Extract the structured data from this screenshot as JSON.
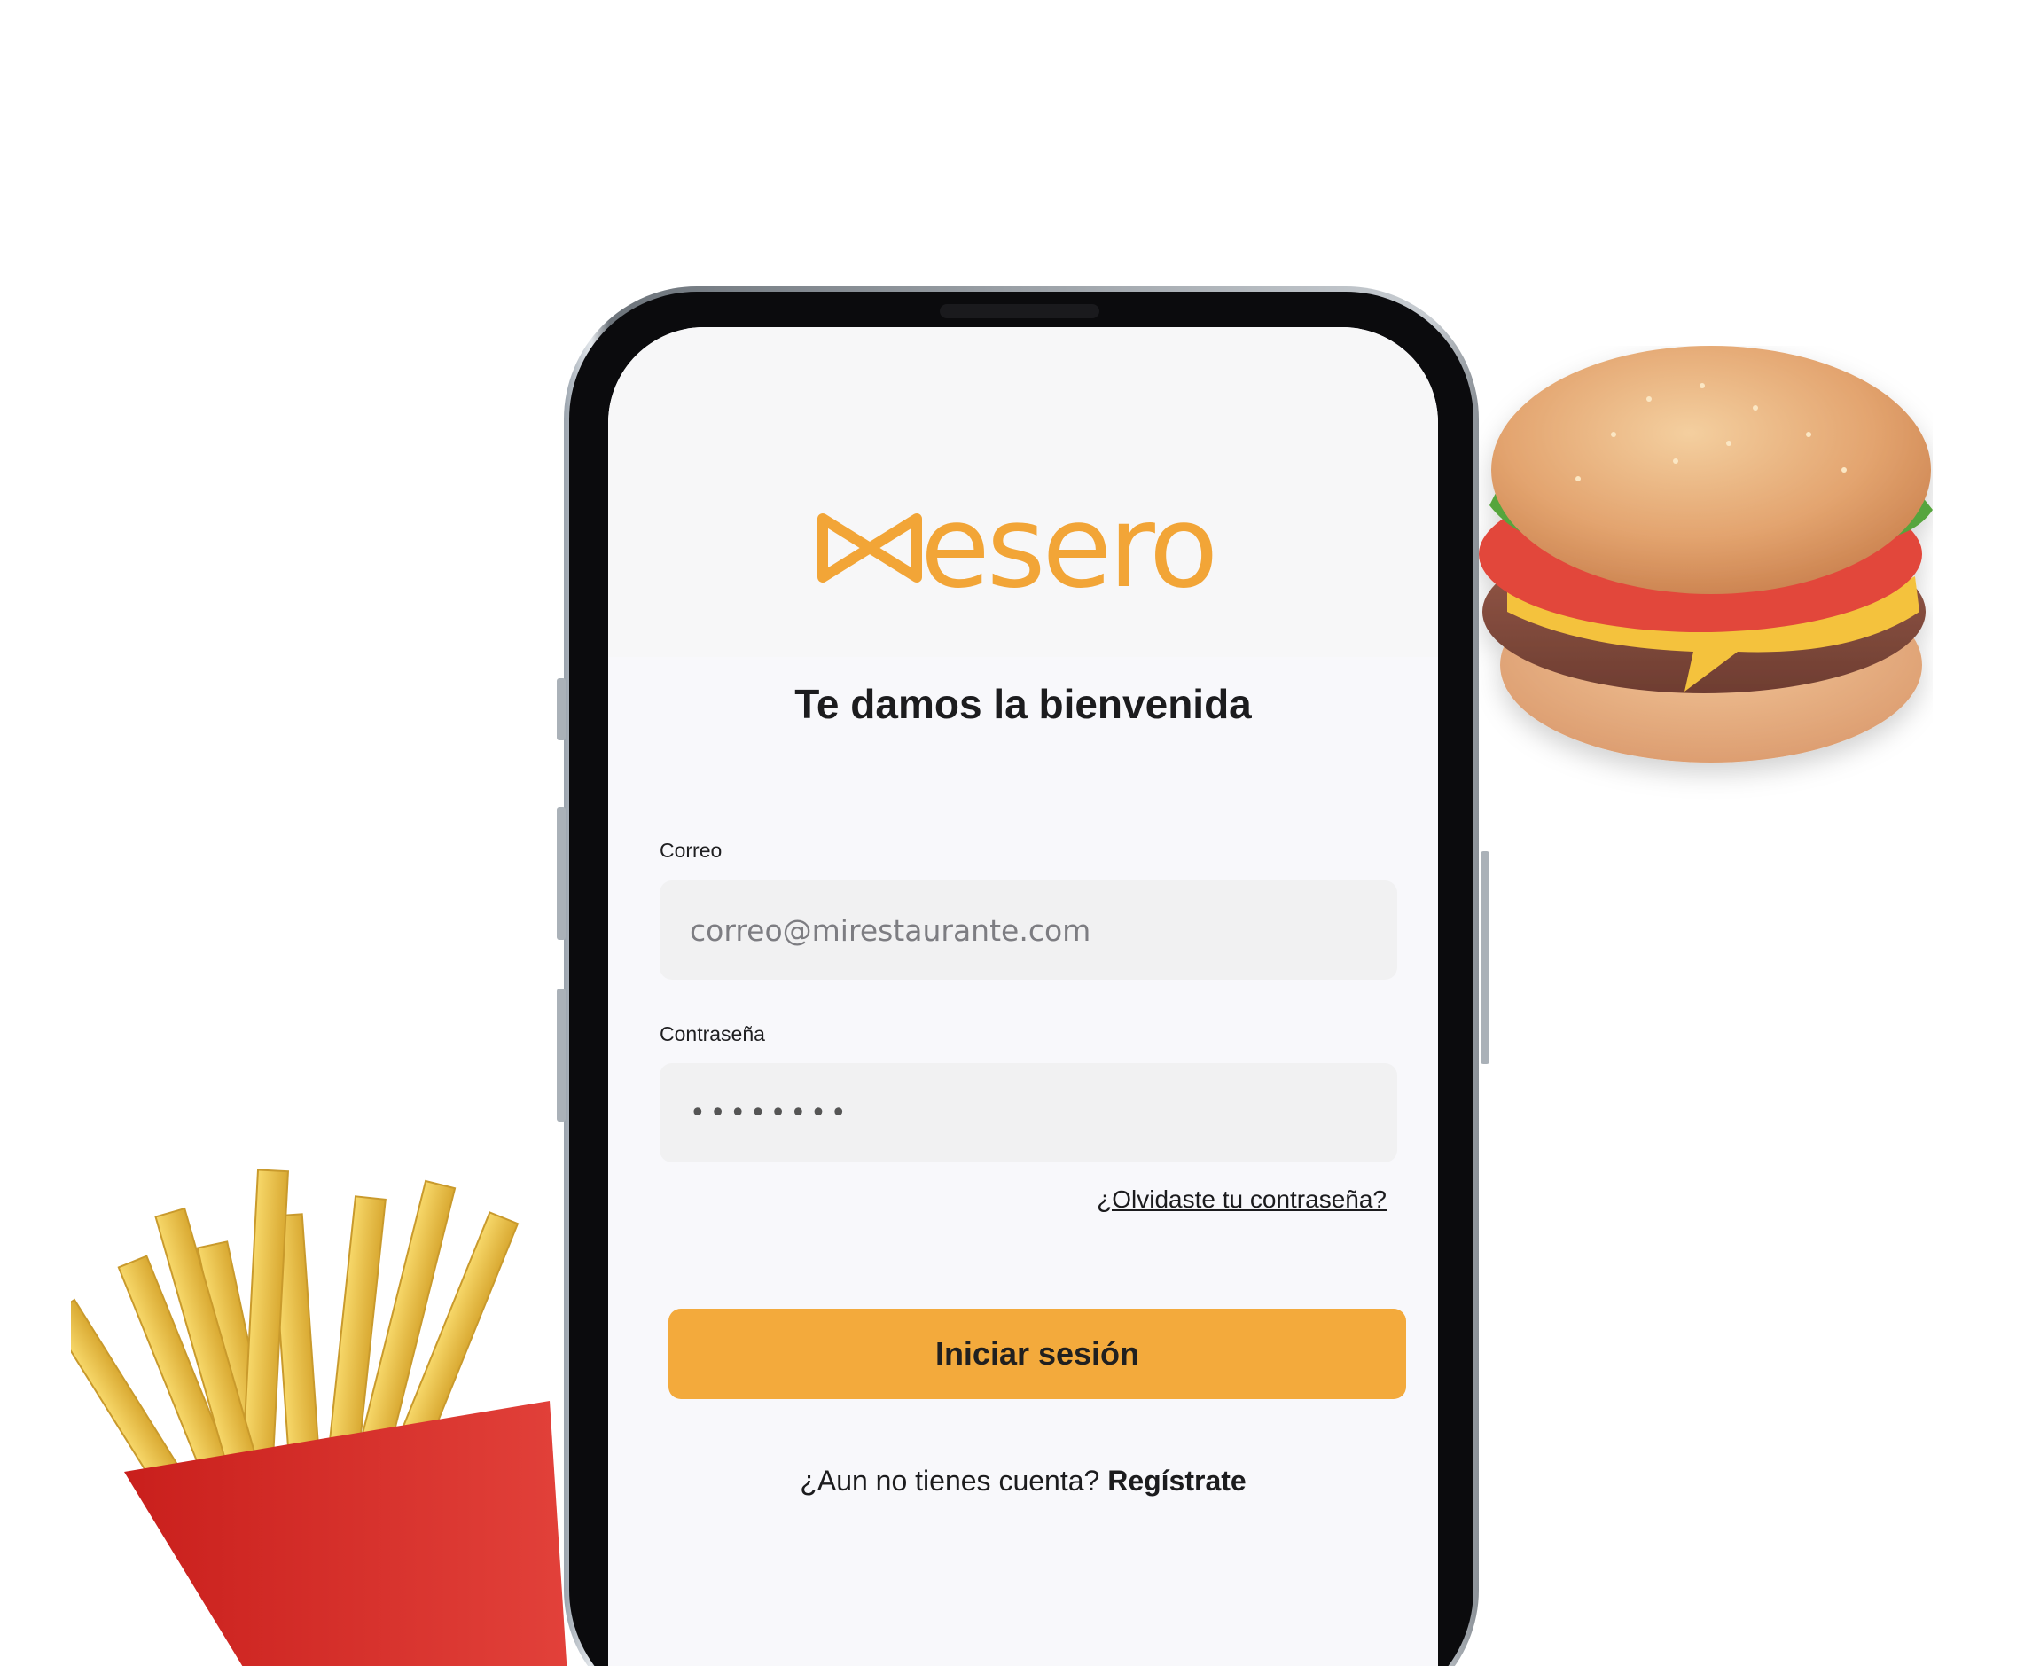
{
  "app": {
    "brand_name": "esero",
    "brand_color": "#f2a537"
  },
  "login": {
    "title": "Te damos la bienvenida",
    "email": {
      "label": "Correo",
      "placeholder": "correo@mirestaurante.com",
      "value": ""
    },
    "password": {
      "label": "Contraseña",
      "value": "••••••••"
    },
    "forgot_link": "¿Olvidaste tu contraseña?",
    "submit_label": "Iniciar sesión",
    "submit_color": "#f3aa3c",
    "signup_prompt": "¿Aun no tienes cuenta?",
    "signup_link": "Regístrate"
  },
  "decor": {
    "items": [
      "hamburger",
      "french-fries"
    ]
  }
}
